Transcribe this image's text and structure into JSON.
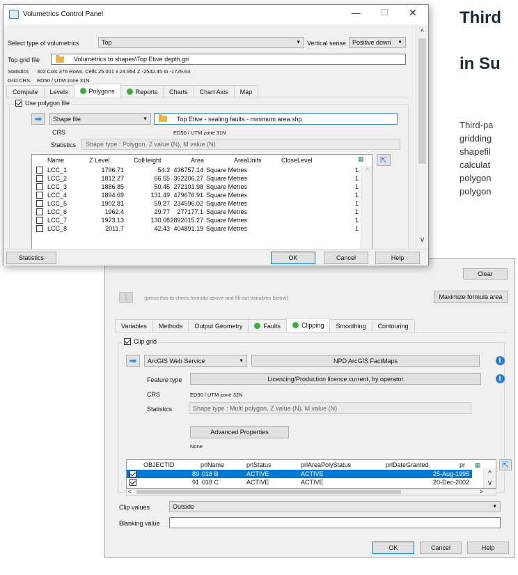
{
  "article": {
    "heading_line1": "Third",
    "heading_line2": "in Su",
    "body": [
      "Third-pa",
      "gridding",
      "shapefil",
      "calculat",
      "polygon",
      "polygon"
    ]
  },
  "back_window": {
    "clear_button": "Clear",
    "hint": "(press this to check formula above and fill out variables below)",
    "maximize_button": "Maximize formula area",
    "tabs": [
      {
        "label": "Variables",
        "dot": false
      },
      {
        "label": "Methods",
        "dot": false
      },
      {
        "label": "Output Geometry",
        "dot": false
      },
      {
        "label": "Faults",
        "dot": true
      },
      {
        "label": "Clipping",
        "dot": true
      },
      {
        "label": "Smoothing",
        "dot": false
      },
      {
        "label": "Contouring",
        "dot": false
      }
    ],
    "clip_grid_label": "Clip grid",
    "source_combo": "ArcGIS Web Service",
    "service_button": "NPD ArcGIS FactMaps",
    "feature_type_label": "Feature type",
    "feature_type_value": "Licencing/Production licence current, by operator",
    "crs_label": "CRS",
    "crs_value": "ED50 / UTM zone 32N",
    "statistics_label": "Statistics",
    "statistics_value": "Shape type : Multi polygon, Z value (N), M value (N)",
    "advanced_button": "Advanced Properties",
    "advanced_value": "None",
    "grid_columns": [
      "OBJECTID",
      "prlName",
      "prlStatus",
      "prlAreaPolyStatus",
      "prlDateGranted",
      "pr"
    ],
    "grid_rows": [
      {
        "checked": true,
        "id": "89",
        "name": "018 B",
        "status": "ACTIVE",
        "area_status": "ACTIVE",
        "date": "25-Aug-1995",
        "selected": true
      },
      {
        "checked": true,
        "id": "91",
        "name": "018 C",
        "status": "ACTIVE",
        "area_status": "ACTIVE",
        "date": "20-Dec-2002",
        "selected": false
      }
    ],
    "clip_values_label": "Clip values",
    "clip_values_value": "Outside",
    "blanking_label": "Blanking value",
    "blanking_value": "",
    "ok": "OK",
    "cancel": "Cancel",
    "help": "Help"
  },
  "front_window": {
    "title": "Volumetrics Control Panel",
    "select_type_label": "Select type of volumetrics",
    "select_type_value": "Top",
    "vertical_sense_label": "Vertical sense",
    "vertical_sense_value": "Positive down",
    "top_grid_label": "Top grid file",
    "top_grid_value": "Volumetrics to shapes\\Top Etive depth.gri",
    "statistics_label": "Statistics",
    "statistics_value": "302 Cols 376 Rows. Cells 25.001 x 24.954 Z -2542.45 to -1729.63",
    "grid_crs_label": "Grid CRS",
    "grid_crs_value": "ED50 / UTM zone 31N",
    "tabs": [
      {
        "label": "Compute",
        "dot": false
      },
      {
        "label": "Levels",
        "dot": false
      },
      {
        "label": "Polygons",
        "dot": true
      },
      {
        "label": "Reports",
        "dot": true
      },
      {
        "label": "Charts",
        "dot": false
      },
      {
        "label": "Chart Axis",
        "dot": false
      },
      {
        "label": "Map",
        "dot": false
      }
    ],
    "use_polygon_label": "Use polygon file",
    "shape_combo": "Shape file",
    "shape_file": "Top Etive - sealing faults - minimum area.shp",
    "crs_label": "CRS",
    "crs_value": "ED50 / UTM zone 31N",
    "stats_label": "Statistics",
    "stats_value": "Shape type : Polygon, Z value (N), M value (N)",
    "grid_columns": [
      "Name",
      "Z Level",
      "ColHeight",
      "Area",
      "AreaUnits",
      "CloseLevel"
    ],
    "grid_rows": [
      {
        "name": "LCC_1",
        "z": "1796.71",
        "col": "54.3",
        "area": "436757.14",
        "units": "Square Metres",
        "close": "1"
      },
      {
        "name": "LCC_2",
        "z": "1812.27",
        "col": "66.55",
        "area": "362206.27",
        "units": "Square Metres",
        "close": "1"
      },
      {
        "name": "LCC_3",
        "z": "1886.85",
        "col": "50.45",
        "area": "272101.98",
        "units": "Square Metres",
        "close": "1"
      },
      {
        "name": "LCC_4",
        "z": "1894.69",
        "col": "131.49",
        "area": "479676.91",
        "units": "Square Metres",
        "close": "1"
      },
      {
        "name": "LCC_5",
        "z": "1902.81",
        "col": "59.27",
        "area": "234596.02",
        "units": "Square Metres",
        "close": "1"
      },
      {
        "name": "LCC_6",
        "z": "1962.4",
        "col": "29.77",
        "area": "277177.1",
        "units": "Square Metres",
        "close": "1"
      },
      {
        "name": "LCC_7",
        "z": "1973.13",
        "col": "130.08",
        "area": "2892015.27",
        "units": "Square Metres",
        "close": "1"
      },
      {
        "name": "LCC_8",
        "z": "2011.7",
        "col": "42.43",
        "area": "404891.19",
        "units": "Square Metres",
        "close": "1"
      }
    ],
    "statistics_button": "Statistics",
    "ok": "OK",
    "cancel": "Cancel",
    "help": "Help"
  }
}
